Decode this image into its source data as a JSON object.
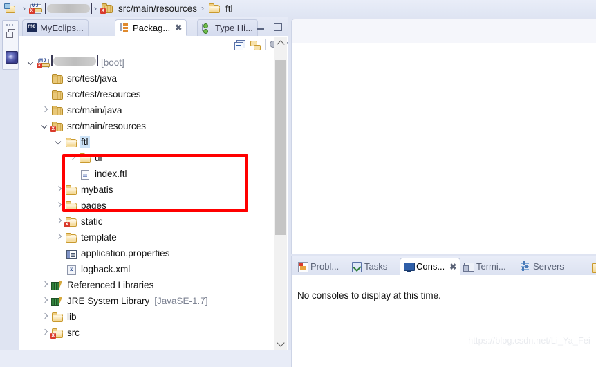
{
  "breadcrumb": {
    "root_icon": "package-explorer-icon",
    "items": [
      {
        "label": "",
        "icon": "project-icon",
        "redacted": true
      },
      {
        "label": "src/main/resources",
        "icon": "source-folder-icon"
      },
      {
        "label": "ftl",
        "icon": "folder-icon"
      }
    ],
    "separator": "›"
  },
  "fastview": {
    "restore_icon": "restore-icon",
    "perspective_icon": "myeclipse-perspective-icon"
  },
  "view_tabs": [
    {
      "label": "MyEclips...",
      "icon": "myeclipse-icon",
      "active": false,
      "closable": false
    },
    {
      "label": "Packag...",
      "icon": "package-explorer-icon",
      "active": true,
      "closable": true
    },
    {
      "label": "Type Hi...",
      "icon": "type-hierarchy-icon",
      "active": false,
      "closable": false
    }
  ],
  "view_window_buttons": {
    "minimize": "minimize-icon",
    "maximize": "maximize-icon"
  },
  "view_toolbar": [
    {
      "name": "collapse-all-icon"
    },
    {
      "name": "link-with-editor-icon"
    },
    {
      "name": "view-filters-icon"
    },
    {
      "name": "view-menu-chevron-icon"
    }
  ],
  "tree": [
    {
      "label": "[REDACTED]",
      "suffix": "[boot]",
      "indent": 0,
      "arrow": "expanded",
      "icon": "java-project-icon",
      "redacted": true,
      "error": true
    },
    {
      "label": "src/test/java",
      "indent": 1,
      "arrow": "none",
      "icon": "source-folder-icon"
    },
    {
      "label": "src/test/resources",
      "indent": 1,
      "arrow": "none",
      "icon": "source-folder-icon"
    },
    {
      "label": "src/main/java",
      "indent": 1,
      "arrow": "collapsed",
      "icon": "source-folder-icon"
    },
    {
      "label": "src/main/resources",
      "indent": 1,
      "arrow": "expanded",
      "icon": "source-folder-icon",
      "error": true
    },
    {
      "label": "ftl",
      "indent": 2,
      "arrow": "expanded",
      "icon": "folder-icon",
      "selected": true
    },
    {
      "label": "ui",
      "indent": 3,
      "arrow": "collapsed",
      "icon": "folder-icon"
    },
    {
      "label": "index.ftl",
      "indent": 3,
      "arrow": "none",
      "icon": "file-icon"
    },
    {
      "label": "mybatis",
      "indent": 2,
      "arrow": "collapsed",
      "icon": "folder-icon"
    },
    {
      "label": "pages",
      "indent": 2,
      "arrow": "collapsed",
      "icon": "folder-icon"
    },
    {
      "label": "static",
      "indent": 2,
      "arrow": "collapsed",
      "icon": "folder-icon",
      "error": true
    },
    {
      "label": "template",
      "indent": 2,
      "arrow": "collapsed",
      "icon": "folder-icon"
    },
    {
      "label": "application.properties",
      "indent": 2,
      "arrow": "none",
      "icon": "properties-file-icon"
    },
    {
      "label": "logback.xml",
      "indent": 2,
      "arrow": "none",
      "icon": "xml-file-icon"
    },
    {
      "label": "Referenced Libraries",
      "indent": 1,
      "arrow": "collapsed",
      "icon": "library-icon"
    },
    {
      "label": "JRE System Library",
      "suffix": "[JavaSE-1.7]",
      "indent": 1,
      "arrow": "collapsed",
      "icon": "library-icon"
    },
    {
      "label": "lib",
      "indent": 1,
      "arrow": "collapsed",
      "icon": "folder-icon"
    },
    {
      "label": "src",
      "indent": 1,
      "arrow": "collapsed",
      "icon": "folder-icon",
      "error": true
    }
  ],
  "annotation": {
    "color": "#ff0000",
    "encloses": [
      "ftl",
      "ui",
      "index.ftl"
    ]
  },
  "scrollbar": {
    "up_icon": "scroll-up-icon",
    "down_icon": "scroll-down-icon"
  },
  "console_tabs": [
    {
      "label": "Probl...",
      "icon": "problems-icon",
      "active": false,
      "closable": false
    },
    {
      "label": "Tasks",
      "icon": "tasks-icon",
      "active": false,
      "closable": false
    },
    {
      "label": "Cons...",
      "icon": "console-icon",
      "active": true,
      "closable": true
    },
    {
      "label": "Termi...",
      "icon": "terminal-icon",
      "active": false,
      "closable": false
    },
    {
      "label": "Servers",
      "icon": "servers-icon",
      "active": false,
      "closable": false
    }
  ],
  "console": {
    "message": "No consoles to display at this time."
  },
  "watermark": {
    "text": "https://blog.csdn.net/Li_Ya_Fei"
  }
}
